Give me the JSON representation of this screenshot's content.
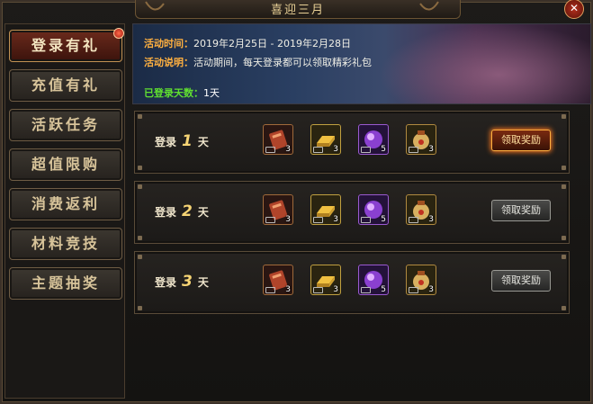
{
  "window": {
    "title": "喜迎三月",
    "close_label": "✕"
  },
  "sidebar": {
    "items": [
      {
        "label": "登录有礼",
        "active": true,
        "has_dot": true
      },
      {
        "label": "充值有礼",
        "active": false
      },
      {
        "label": "活跃任务",
        "active": false
      },
      {
        "label": "超值限购",
        "active": false
      },
      {
        "label": "消费返利",
        "active": false
      },
      {
        "label": "材料竞技",
        "active": false
      },
      {
        "label": "主题抽奖",
        "active": false
      }
    ]
  },
  "banner": {
    "time_label": "活动时间：",
    "time_value": "2019年2月25日 - 2019年2月28日",
    "desc_label": "活动说明：",
    "desc_value": "活动期间，每天登录都可以领取精彩礼包",
    "logged_label": "已登录天数：",
    "logged_value": "1天"
  },
  "rows": [
    {
      "prefix": "登录",
      "day": "1",
      "suffix": "天",
      "button": "领取奖励",
      "items": [
        {
          "icon": "book-icon",
          "count": "3"
        },
        {
          "icon": "gold-bar-icon",
          "count": "3"
        },
        {
          "icon": "purple-orb-icon",
          "count": "5"
        },
        {
          "icon": "gift-bag-icon",
          "count": "3"
        }
      ]
    },
    {
      "prefix": "登录",
      "day": "2",
      "suffix": "天",
      "button": "领取奖励",
      "items": [
        {
          "icon": "book-icon",
          "count": "3"
        },
        {
          "icon": "gold-bar-icon",
          "count": "3"
        },
        {
          "icon": "purple-orb-icon",
          "count": "5"
        },
        {
          "icon": "gift-bag-icon",
          "count": "3"
        }
      ]
    },
    {
      "prefix": "登录",
      "day": "3",
      "suffix": "天",
      "button": "领取奖励",
      "items": [
        {
          "icon": "book-icon",
          "count": "3"
        },
        {
          "icon": "gold-bar-icon",
          "count": "3"
        },
        {
          "icon": "purple-orb-icon",
          "count": "5"
        },
        {
          "icon": "gift-bag-icon",
          "count": "3"
        }
      ]
    }
  ]
}
